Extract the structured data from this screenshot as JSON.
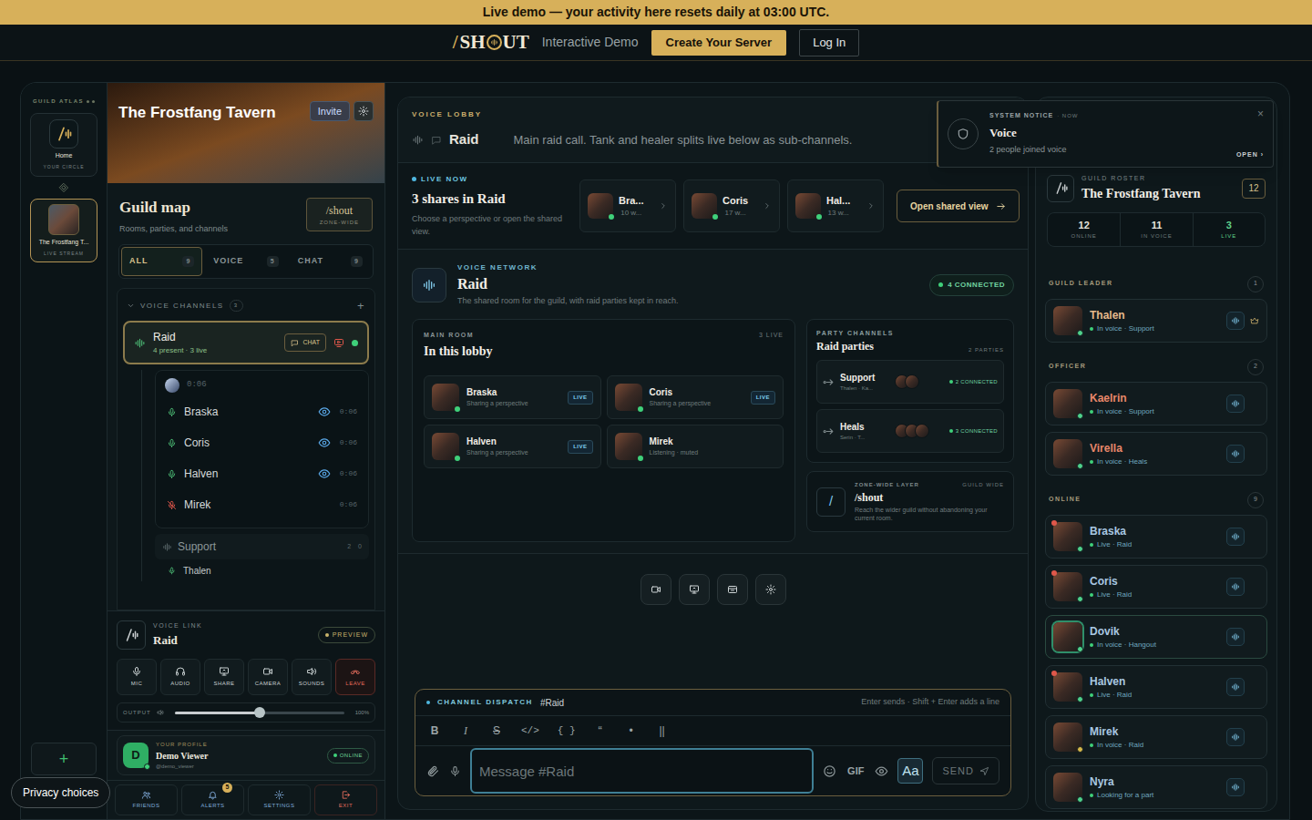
{
  "banner": {
    "text": "Live demo — your activity here resets daily at 03:00 UTC."
  },
  "topbar": {
    "logo": {
      "slash": "/",
      "left": "SH",
      "right": "UT"
    },
    "subtitle": "Interactive Demo",
    "primary_button": "Create Your Server",
    "login_button": "Log In"
  },
  "rail": {
    "label": "GUILD ATLAS",
    "items": [
      {
        "name": "Home",
        "sub": "YOUR CIRCLE",
        "kind": "home",
        "selected": false
      },
      {
        "name": "The Frostfang T...",
        "sub": "LIVE STREAM",
        "kind": "guild",
        "selected": true
      }
    ],
    "add": "+"
  },
  "guild_header": {
    "title": "The Frostfang Tavern",
    "invite": "Invite"
  },
  "guild_map": {
    "title": "Guild map",
    "subtitle": "Rooms, parties, and channels",
    "button": {
      "label": "/shout",
      "sub": "ZONE-WIDE"
    }
  },
  "filters": [
    {
      "label": "ALL",
      "count": "9",
      "selected": true
    },
    {
      "label": "VOICE",
      "count": "5",
      "selected": false
    },
    {
      "label": "CHAT",
      "count": "9",
      "selected": false
    }
  ],
  "voice_channels": {
    "label": "VOICE CHANNELS",
    "count": "3",
    "add": "+",
    "expanded": true,
    "channel": {
      "name": "Raid",
      "sub": "4 present · 3 live",
      "chat": "CHAT",
      "selected": true,
      "timer": "0:06",
      "members": [
        {
          "name": "Braska",
          "time": "0:06",
          "muted": false,
          "watching": true
        },
        {
          "name": "Coris",
          "time": "0:06",
          "muted": false,
          "watching": true
        },
        {
          "name": "Halven",
          "time": "0:06",
          "muted": false,
          "watching": true
        },
        {
          "name": "Mirek",
          "time": "0:06",
          "muted": true,
          "watching": false
        }
      ]
    },
    "subchannels": [
      {
        "name": "Support",
        "count": "2",
        "extra": "0",
        "members": [
          "Thalen"
        ]
      }
    ]
  },
  "voice_link": {
    "label": "VOICE LINK",
    "title": "Raid",
    "badge": "PREVIEW",
    "controls": [
      {
        "label": "MIC",
        "kind": "mic",
        "danger": false
      },
      {
        "label": "AUDIO",
        "kind": "audio",
        "danger": false
      },
      {
        "label": "SHARE",
        "kind": "share",
        "danger": false
      },
      {
        "label": "CAMERA",
        "kind": "camera",
        "danger": false
      },
      {
        "label": "SOUNDS",
        "kind": "sounds",
        "danger": false
      },
      {
        "label": "LEAVE",
        "kind": "leave",
        "danger": true
      }
    ],
    "output": {
      "label": "OUTPUT",
      "level": 0.5,
      "reading": "100%"
    }
  },
  "profile": {
    "initial": "D",
    "label": "YOUR PROFILE",
    "name": "Demo Viewer",
    "handle": "@demo_viewer",
    "status": "ONLINE"
  },
  "bottom_nav": [
    {
      "label": "FRIENDS",
      "kind": "friends",
      "danger": false
    },
    {
      "label": "ALERTS",
      "kind": "alerts",
      "danger": false,
      "badge": "5"
    },
    {
      "label": "SETTINGS",
      "kind": "settings",
      "danger": false
    },
    {
      "label": "EXIT",
      "kind": "exit",
      "danger": true
    }
  ],
  "privacy": {
    "label": "Privacy choices"
  },
  "lobby": {
    "label": "VOICE LOBBY",
    "title": "Raid",
    "description": "Main raid call. Tank and healer splits live below as sub-channels."
  },
  "notice": {
    "label": "SYSTEM NOTICE",
    "meta": "· NOW",
    "title": "Voice",
    "body": "2 people joined voice",
    "action": "OPEN ›",
    "close": "×"
  },
  "live": {
    "label": "LIVE NOW",
    "title": "3 shares in Raid",
    "description": "Choose a perspective or open the shared view.",
    "shares": [
      {
        "name": "Bra...",
        "time": "10 w..."
      },
      {
        "name": "Coris",
        "time": "17 w..."
      },
      {
        "name": "Hal...",
        "time": "13 w..."
      }
    ],
    "button": "Open shared view"
  },
  "network": {
    "label": "VOICE NETWORK",
    "title": "Raid",
    "description": "The shared room for the guild, with raid parties kept in reach.",
    "connected": "4 CONNECTED",
    "main_room": {
      "label": "MAIN ROOM",
      "count": "3 LIVE",
      "title": "In this lobby",
      "live_badge": "LIVE",
      "members": [
        {
          "name": "Braska",
          "status": "Sharing a perspective",
          "live": true
        },
        {
          "name": "Coris",
          "status": "Sharing a perspective",
          "live": true
        },
        {
          "name": "Halven",
          "status": "Sharing a perspective",
          "live": true
        },
        {
          "name": "Mirek",
          "status": "Listening · muted",
          "live": false
        }
      ]
    },
    "parties": {
      "label": "PARTY CHANNELS",
      "title": "Raid parties",
      "count": "2 PARTIES",
      "items": [
        {
          "name": "Support",
          "members": "Thalen · Ka...",
          "avatars": 2,
          "connected": "2 CONNECTED"
        },
        {
          "name": "Heals",
          "members": "Serin · T...",
          "avatars": 3,
          "connected": "3 CONNECTED"
        }
      ]
    },
    "zone": {
      "label": "ZONE-WIDE LAYER",
      "badge": "GUILD WIDE",
      "icon": "/",
      "title": "/shout",
      "description": "Reach the wider guild without abandoning your current room."
    }
  },
  "call_controls": [
    {
      "kind": "camera"
    },
    {
      "kind": "screen"
    },
    {
      "kind": "panel"
    },
    {
      "kind": "settings"
    }
  ],
  "composer": {
    "label": "CHANNEL DISPATCH",
    "channel": "#Raid",
    "hint": "Enter sends · Shift + Enter adds a line",
    "toolbar": [
      {
        "label": "B",
        "kind": "bold"
      },
      {
        "label": "I",
        "kind": "italic"
      },
      {
        "label": "S",
        "kind": "strike"
      },
      {
        "label": "</>",
        "kind": "code"
      },
      {
        "label": "{ }",
        "kind": "block"
      },
      {
        "label": "“",
        "kind": "quote"
      },
      {
        "label": "•",
        "kind": "list"
      },
      {
        "label": "||",
        "kind": "spoiler"
      }
    ],
    "placeholder": "Message #Raid",
    "gif": "GIF",
    "font_toggle": {
      "label": "Aa",
      "selected": true
    },
    "send": "SEND"
  },
  "roster": {
    "label": "GUILD ROSTER",
    "title": "The Frostfang Tavern",
    "count": "12",
    "stats": [
      {
        "value": "12",
        "label": "ONLINE",
        "highlight": false
      },
      {
        "value": "11",
        "label": "IN VOICE",
        "highlight": false
      },
      {
        "value": "3",
        "label": "LIVE",
        "highlight": true
      }
    ],
    "sections": [
      {
        "label": "GUILD LEADER",
        "count": "1",
        "color": "#e6b98c",
        "members": [
          {
            "name": "Thalen",
            "status": "In voice · Support",
            "live": false,
            "dot": "#4fd18b",
            "crown": true,
            "highlighted": false
          }
        ]
      },
      {
        "label": "OFFICER",
        "count": "2",
        "color": "#e8876a",
        "members": [
          {
            "name": "Kaelrin",
            "status": "In voice · Support",
            "live": false,
            "dot": "#4fd18b",
            "crown": false,
            "highlighted": false
          },
          {
            "name": "Virella",
            "status": "In voice · Heals",
            "live": false,
            "dot": "#4fd18b",
            "crown": false,
            "highlighted": false
          }
        ]
      },
      {
        "label": "ONLINE",
        "count": "9",
        "color": "#a9c8e2",
        "members": [
          {
            "name": "Braska",
            "status": "Live · Raid",
            "live": true,
            "dot": "#4fd18b",
            "crown": false,
            "highlighted": false
          },
          {
            "name": "Coris",
            "status": "Live · Raid",
            "live": true,
            "dot": "#4fd18b",
            "crown": false,
            "highlighted": false
          },
          {
            "name": "Dovik",
            "status": "In voice · Hangout",
            "live": false,
            "dot": "#4fd18b",
            "crown": false,
            "highlighted": true
          },
          {
            "name": "Halven",
            "status": "Live · Raid",
            "live": true,
            "dot": "#4fd18b",
            "crown": false,
            "highlighted": false
          },
          {
            "name": "Mirek",
            "status": "In voice · Raid",
            "live": false,
            "dot": "#d6b84a",
            "crown": false,
            "highlighted": false
          },
          {
            "name": "Nyra",
            "status": "Looking for a part",
            "live": false,
            "dot": "#4fd18b",
            "crown": false,
            "highlighted": false
          }
        ]
      }
    ]
  }
}
